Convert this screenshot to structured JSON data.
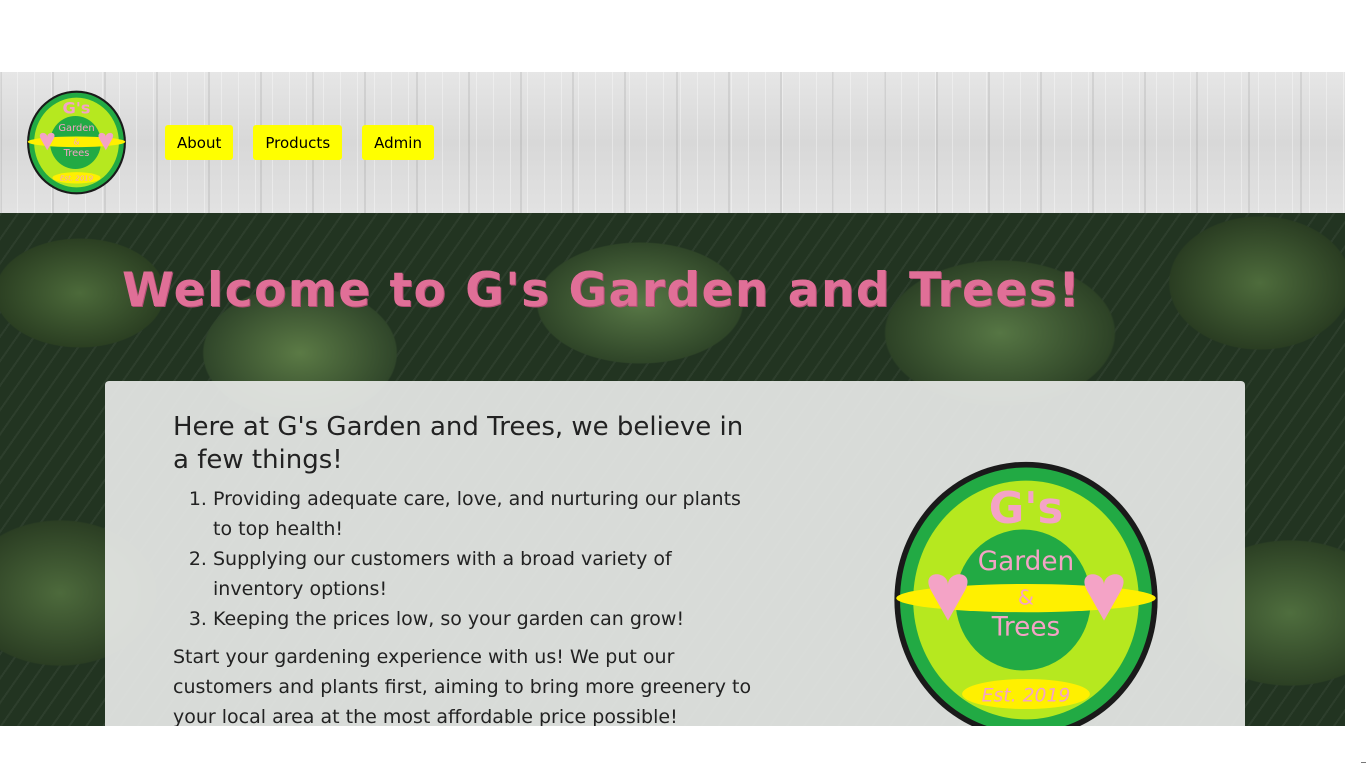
{
  "header": {
    "logo": {
      "line1": "G's",
      "line2": "Garden",
      "line3": "&",
      "line4": "Trees",
      "badge": "Est. 2019"
    },
    "nav": [
      {
        "label": "About"
      },
      {
        "label": "Products"
      },
      {
        "label": "Admin"
      }
    ]
  },
  "hero": {
    "title": "Welcome to G's Garden and Trees!",
    "card": {
      "heading": "Here at G's Garden and Trees, we believe in a few things!",
      "beliefs": [
        "Providing adequate care, love, and nurturing our plants to top health!",
        "Supplying our customers with a broad variety of inventory options!",
        "Keeping the prices low, so your garden can grow!"
      ],
      "intro": "Start your gardening experience with us! We put our customers and plants first, aiming to bring more greenery to your local area at the most affordable price possible!"
    },
    "logo": {
      "line1": "G's",
      "line2": "Garden",
      "line3": "&",
      "line4": "Trees",
      "badge": "Est. 2019"
    }
  },
  "colors": {
    "nav_button": "#ffff00",
    "title_pink": "#e06f97",
    "logo_green": "#22aa44",
    "logo_lime": "#b6e81f",
    "logo_pink": "#f4a3c6"
  }
}
